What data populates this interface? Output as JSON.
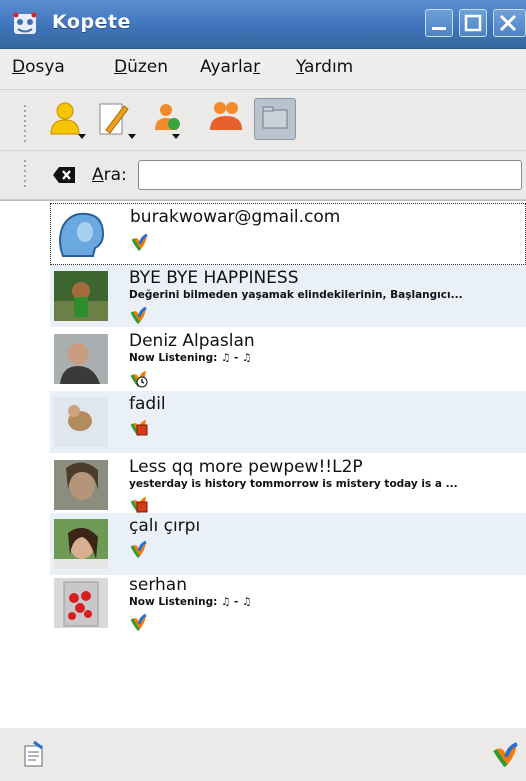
{
  "window": {
    "title": "Kopete",
    "buttons": [
      "minimize-icon",
      "maximize-icon",
      "close-icon"
    ],
    "titlebar_color": "#4a80c6"
  },
  "menu": {
    "items": [
      {
        "label": "Dosya"
      },
      {
        "label": "Düzen"
      },
      {
        "label": "Ayarlar"
      },
      {
        "label": "Yardım"
      }
    ]
  },
  "toolbar": {
    "buttons": [
      "set-status-icon",
      "edit-account-icon",
      "add-contact-icon",
      "groups-icon",
      "show-offline-icon"
    ]
  },
  "search": {
    "label": "Ara:",
    "value": "",
    "clear_icon": "clear-search-icon"
  },
  "contacts": [
    {
      "name": "burakwowar@gmail.com",
      "message": "",
      "status": "online",
      "avatar": "default-avatar-icon"
    },
    {
      "name": "BYE BYE HAPPINESS",
      "message": "Değerini bilmeden yaşamak elindekilerinin, Başlangıcı...",
      "status": "online",
      "avatar": "photo"
    },
    {
      "name": "Deniz Alpaslan",
      "message": "Now Listening: ♫ - ♫",
      "status": "away",
      "avatar": "photo"
    },
    {
      "name": "fadil",
      "message": "",
      "status": "busy",
      "avatar": "photo"
    },
    {
      "name": "Less qq more pewpew!!L2P",
      "message": "yesterday is history tommorrow is mistery today is a ...",
      "status": "busy",
      "avatar": "photo"
    },
    {
      "name": "çalı çırpı",
      "message": "",
      "status": "online",
      "avatar": "photo"
    },
    {
      "name": "serhan",
      "message": "Now Listening: ♫ - ♫",
      "status": "online",
      "avatar": "photo"
    }
  ],
  "statusbar": {
    "left_icon": "info-notes-icon",
    "right_icon": "msn-status-icon"
  }
}
